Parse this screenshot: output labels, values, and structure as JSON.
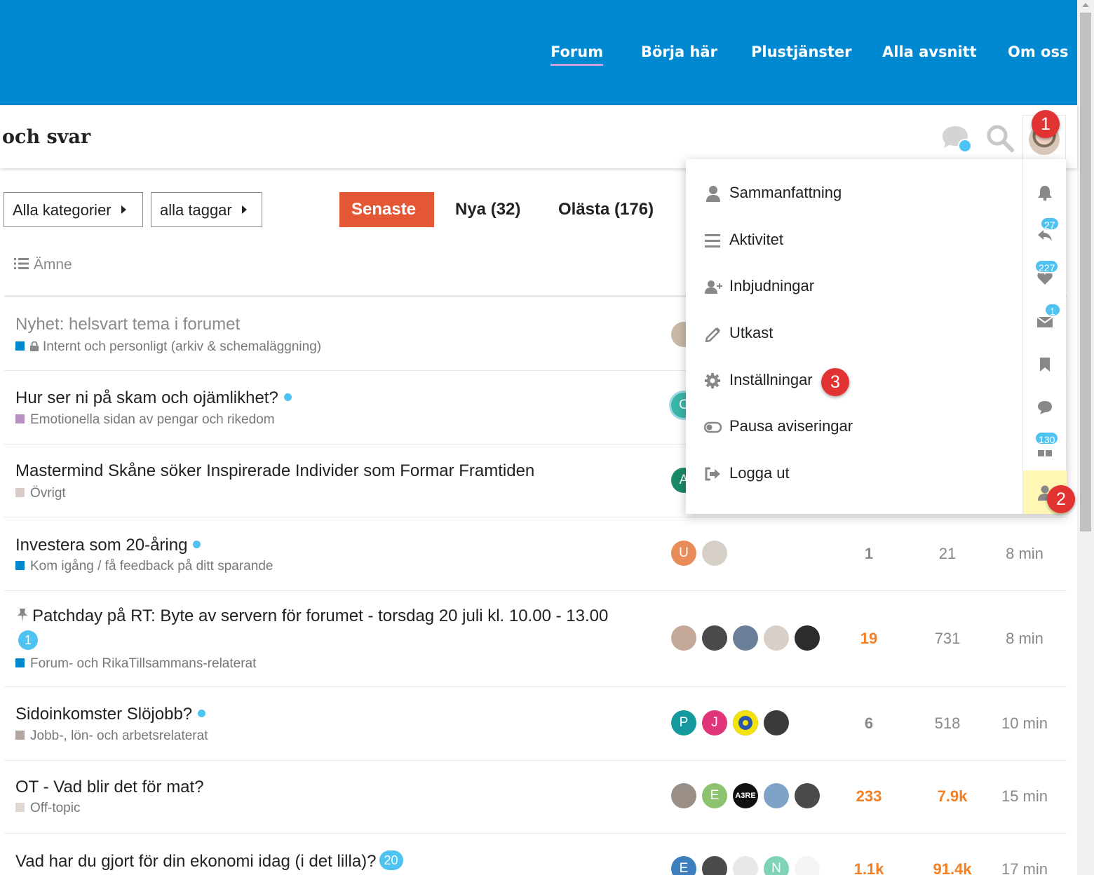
{
  "topnav": {
    "links": [
      "Forum",
      "Börja här",
      "Plustjänster",
      "Alla avsnitt",
      "Om oss"
    ],
    "active": "Forum"
  },
  "header": {
    "site_title": "och svar"
  },
  "markers": [
    "1",
    "2",
    "3"
  ],
  "filters": {
    "category": "Alla kategorier",
    "tags": "alla taggar",
    "tabs": [
      "Senaste",
      "Nya (32)",
      "Olästa (176)"
    ],
    "active_tab": "Senaste"
  },
  "list_header": {
    "topic": "Ämne"
  },
  "topics": [
    {
      "title": "Nyhet: helsvart tema i forumet",
      "category": "Internt och personligt (arkiv & schemaläggning)",
      "category_color": "#0088cc",
      "read": true
    },
    {
      "title": "Hur ser ni på skam och ojämlikhet?",
      "category": "Emotionella sidan av pengar och rikedom",
      "category_color": "#b88fc0",
      "new": true
    },
    {
      "title": "Mastermind Skåne söker Inspirerade Individer som Formar Framtiden",
      "category": "Övrigt",
      "category_color": "#d9ccc8"
    },
    {
      "title": "Investera som 20-åring",
      "category": "Kom igång / få feedback på ditt sparande",
      "category_color": "#0088cc",
      "new": true,
      "posters": [
        "U"
      ],
      "replies": "1",
      "views": "21",
      "activity": "8 min"
    },
    {
      "title": "Patchday på RT: Byte av servern för forumet - torsdag 20 juli kl. 10.00 - 13.00",
      "badge": "1",
      "category": "Forum- och RikaTillsammans-relaterat",
      "category_color": "#0088cc",
      "pinned": true,
      "replies": "19",
      "views": "731",
      "activity": "8 min"
    },
    {
      "title": "Sidoinkomster Slöjobb?",
      "category": "Jobb-, lön- och arbetsrelaterat",
      "category_color": "#b3a6a0",
      "new": true,
      "posters": [
        "P",
        "J"
      ],
      "replies": "6",
      "views": "518",
      "activity": "10 min"
    },
    {
      "title": "OT - Vad blir det för mat?",
      "category": "Off-topic",
      "category_color": "#e0d6d2",
      "posters": [
        "E",
        "A3RE"
      ],
      "replies": "233",
      "views": "7.9k",
      "activity": "15 min"
    },
    {
      "title": "Vad har du gjort för din ekonomi idag (i det lilla)?",
      "badge": "20",
      "posters": [
        "E",
        "N"
      ],
      "replies": "1.1k",
      "views": "91.4k",
      "activity": "17 min"
    }
  ],
  "partial_posters": [
    "C",
    "A"
  ],
  "user_menu": {
    "items": [
      "Sammanfattning",
      "Aktivitet",
      "Inbjudningar",
      "Utkast",
      "Inställningar",
      "Pausa aviseringar",
      "Logga ut"
    ],
    "quick_badges": {
      "replies": "27",
      "likes": "227",
      "messages": "1",
      "other": "130"
    }
  },
  "colors": {
    "brand_blue": "#0088d1",
    "accent_red": "#e45735",
    "hot_orange": "#f57f23",
    "unread_blue": "#4ec2f0",
    "marker_red": "#e23333"
  }
}
